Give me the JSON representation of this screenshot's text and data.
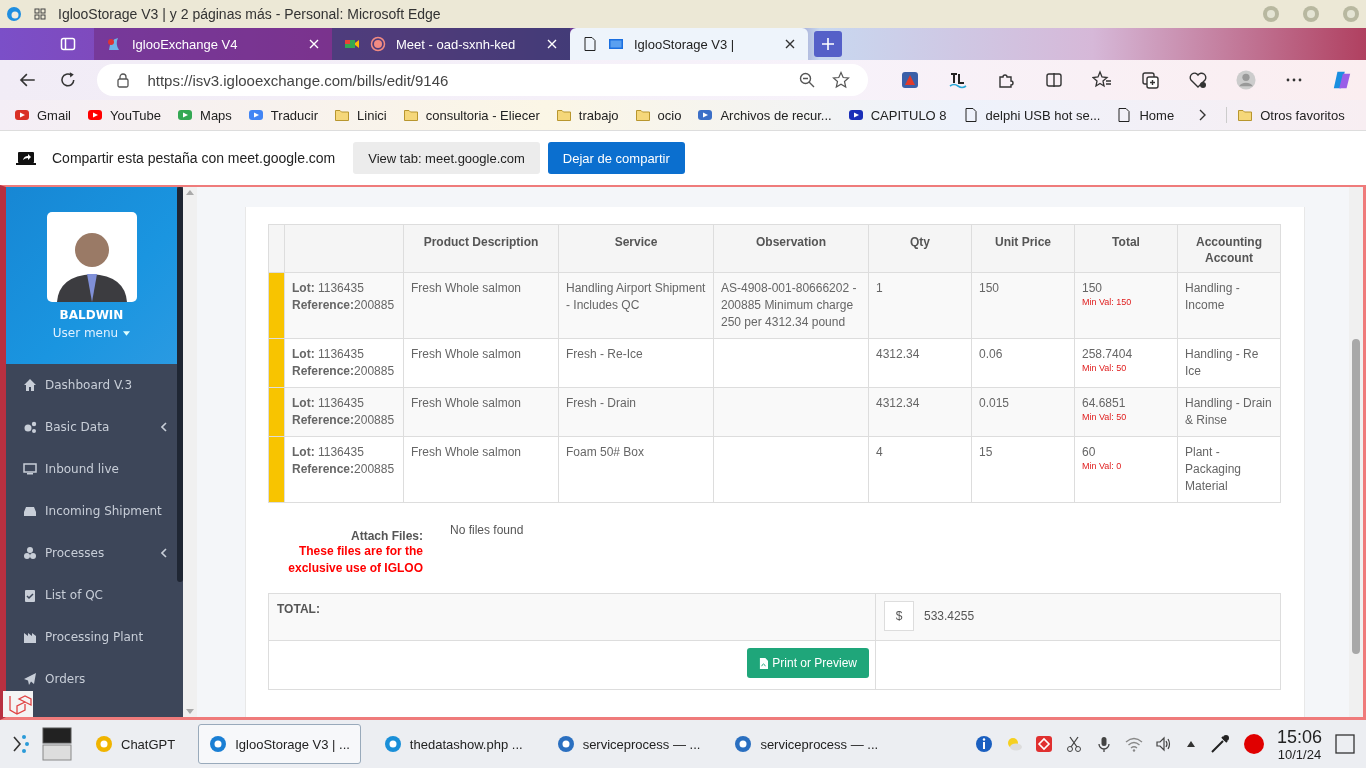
{
  "window": {
    "title": "IglooStorage V3 | y 2 páginas más - Personal: Microsoft Edge"
  },
  "tabs": [
    {
      "label": "IglooExchange V4",
      "selected": false
    },
    {
      "label": "Meet - oad-sxnh-ked",
      "selected": false
    },
    {
      "label": "IglooStorage V3 |",
      "selected": true
    }
  ],
  "address_bar": {
    "url": "https://isv3.iglooexchange.com/bills/edit/9146"
  },
  "bookmarks": [
    {
      "label": "Gmail",
      "kind": "site"
    },
    {
      "label": "YouTube",
      "kind": "site"
    },
    {
      "label": "Maps",
      "kind": "site"
    },
    {
      "label": "Traducir",
      "kind": "site"
    },
    {
      "label": "Linici",
      "kind": "folder"
    },
    {
      "label": "consultoria - Eliecer",
      "kind": "folder"
    },
    {
      "label": "trabajo",
      "kind": "folder"
    },
    {
      "label": "ocio",
      "kind": "folder"
    },
    {
      "label": "Archivos de recur...",
      "kind": "site"
    },
    {
      "label": "CAPITULO 8",
      "kind": "site"
    },
    {
      "label": "delphi USB hot se...",
      "kind": "page"
    },
    {
      "label": "Home",
      "kind": "page"
    }
  ],
  "other_bookmarks": "Otros favoritos",
  "share_bar": {
    "message": "Compartir esta pestaña con meet.google.com",
    "view_button": "View tab: meet.google.com",
    "stop_button": "Dejar de compartir"
  },
  "sidebar": {
    "user": "BALDWIN",
    "user_menu": "User menu",
    "items": [
      {
        "label": "Dashboard V.3",
        "expandable": false
      },
      {
        "label": "Basic Data",
        "expandable": true
      },
      {
        "label": "Inbound live",
        "expandable": false
      },
      {
        "label": "Incoming Shipment",
        "expandable": false
      },
      {
        "label": "Processes",
        "expandable": true
      },
      {
        "label": "List of QC",
        "expandable": false
      },
      {
        "label": "Processing Plant",
        "expandable": false
      },
      {
        "label": "Orders",
        "expandable": false
      }
    ]
  },
  "table": {
    "columns": [
      "Product Description",
      "Service",
      "Observation",
      "Qty",
      "Unit Price",
      "Total",
      "Accounting Account"
    ],
    "rows": [
      {
        "lot": "**Lot:** 1136435",
        "reference": "**Reference:**200885",
        "product": "Fresh Whole salmon",
        "service": "Handling Airport Shipment - Includes QC",
        "observation": "AS-4908-001-80666202 - 200885 Minimum charge 250 per 4312.34 pound",
        "qty": "1",
        "unit_price": "150",
        "total": "150",
        "min_val": "Min Val: 150",
        "account": "Handling - Income"
      },
      {
        "lot": "**Lot:** 1136435",
        "reference": "**Reference:**200885",
        "product": "Fresh Whole salmon",
        "service": "Fresh - Re-Ice",
        "qty": "4312.34",
        "unit_price": "0.06",
        "total": "258.7404",
        "min_val": "Min Val: 50",
        "account": "Handling - Re Ice"
      },
      {
        "lot": "**Lot:** 1136435",
        "reference": "**Reference:**200885",
        "product": "Fresh Whole salmon",
        "service": "Fresh - Drain",
        "qty": "4312.34",
        "unit_price": "0.015",
        "total": "64.6851",
        "min_val": "Min Val: 50",
        "account": "Handling - Drain & Rinse"
      },
      {
        "lot": "**Lot:** 1136435",
        "reference": "**Reference:**200885",
        "product": "Fresh Whole salmon",
        "service": "Foam 50# Box",
        "qty": "4",
        "unit_price": "15",
        "total": "60",
        "min_val": "Min Val: 0",
        "account": "Plant - Packaging Material"
      }
    ]
  },
  "attachments": {
    "label": "Attach Files:",
    "warning": "These files are for the exclusive use of IGLOO",
    "status": "No files found"
  },
  "total": {
    "label": "TOTAL:",
    "currency": "$",
    "value": "533.4255"
  },
  "print_button": "Print or Preview",
  "taskbar": {
    "items": [
      {
        "label": "ChatGPT",
        "selected": false
      },
      {
        "label": "IglooStorage V3 | ...",
        "selected": true
      },
      {
        "label": "thedatashow.php ...",
        "selected": false
      },
      {
        "label": "serviceprocess — ...",
        "selected": false
      },
      {
        "label": "serviceprocess — ...",
        "selected": false
      }
    ],
    "time": "15:06",
    "date": "10/1/24"
  }
}
